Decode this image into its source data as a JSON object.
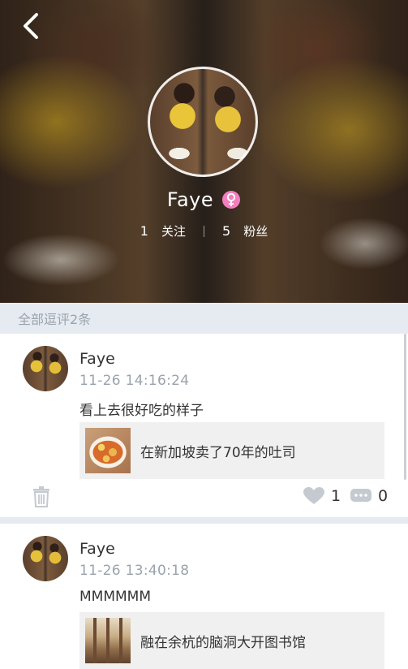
{
  "profile": {
    "name": "Faye",
    "gender_icon": "female-icon",
    "gender_color": "#f47fbf",
    "stats": {
      "following_count": "1",
      "following_label": "关注",
      "followers_count": "5",
      "followers_label": "粉丝"
    }
  },
  "section": {
    "header": "全部逗评2条"
  },
  "comments": [
    {
      "author": "Faye",
      "time": "11-26  14:16:24",
      "text": "看上去很好吃的样子",
      "link": {
        "title": "在新加坡卖了70年的吐司",
        "thumb": "food-thumbnail"
      },
      "likes": "1",
      "replies": "0"
    },
    {
      "author": "Faye",
      "time": "11-26  13:40:18",
      "text": "MMMMMM",
      "link": {
        "title": "融在余杭的脑洞大开图书馆",
        "thumb": "library-thumbnail"
      }
    }
  ],
  "colors": {
    "section_bg": "#e6ebf2",
    "muted_text": "#9aa3ad",
    "icon_gray": "#c5cad1"
  }
}
